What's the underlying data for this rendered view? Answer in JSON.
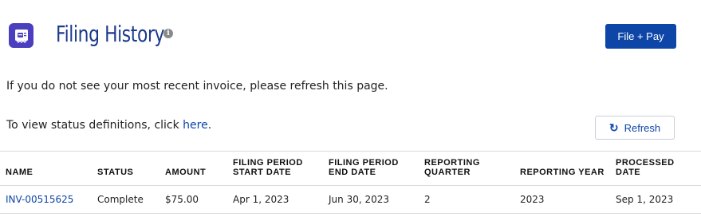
{
  "header": {
    "title": "Filing History",
    "info_icon": "info-icon",
    "file_pay_label": "File + Pay"
  },
  "notes": {
    "refresh_hint": "If you do not see your most recent invoice, please refresh this page.",
    "status_prefix": "To view status definitions, click ",
    "status_link": "here",
    "status_suffix": "."
  },
  "refresh": {
    "label": "Refresh",
    "icon": "refresh-icon"
  },
  "table": {
    "columns": [
      "NAME",
      "STATUS",
      "AMOUNT",
      "FILING PERIOD START DATE",
      "FILING PERIOD END DATE",
      "REPORTING QUARTER",
      "REPORTING YEAR",
      "PROCESSED DATE"
    ],
    "rows": [
      {
        "name": "INV-00515625",
        "status": "Complete",
        "amount": "$75.00",
        "start": "Apr 1, 2023",
        "end": "Jun 30, 2023",
        "quarter": "2",
        "year": "2023",
        "processed": "Sep 1, 2023"
      }
    ]
  },
  "colors": {
    "accent": "#0e46a8",
    "icon_bg": "#4b3fbf"
  }
}
